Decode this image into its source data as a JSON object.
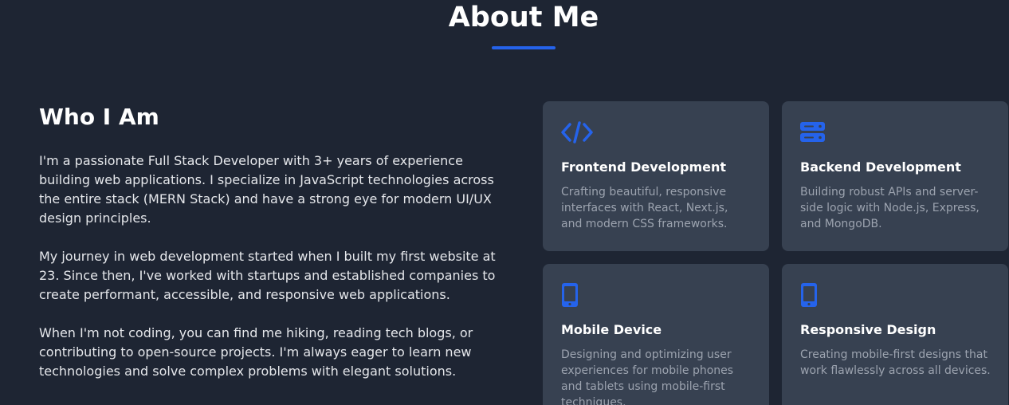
{
  "section": {
    "title": "About Me",
    "accent_color": "#2563eb"
  },
  "who": {
    "heading": "Who I Am",
    "paragraphs": [
      "I'm a passionate Full Stack Developer with 3+ years of experience building web applications. I specialize in JavaScript technologies across the entire stack (MERN Stack) and have a strong eye for modern UI/UX design principles.",
      "My journey in web development started when I built my first website at 23. Since then, I've worked with startups and established companies to create performant, accessible, and responsive web applications.",
      "When I'm not coding, you can find me hiking, reading tech blogs, or contributing to open-source projects. I'm always eager to learn new technologies and solve complex problems with elegant solutions."
    ]
  },
  "cards": [
    {
      "icon": "code-icon",
      "title": "Frontend Development",
      "description": "Crafting beautiful, responsive interfaces with React, Next.js, and modern CSS frameworks."
    },
    {
      "icon": "server-icon",
      "title": "Backend Development",
      "description": "Building robust APIs and server-side logic with Node.js, Express, and MongoDB."
    },
    {
      "icon": "mobile-icon",
      "title": "Mobile Device",
      "description": "Designing and optimizing user experiences for mobile phones and tablets using mobile-first techniques."
    },
    {
      "icon": "mobile-icon",
      "title": "Responsive Design",
      "description": "Creating mobile-first designs that work flawlessly across all devices."
    }
  ]
}
